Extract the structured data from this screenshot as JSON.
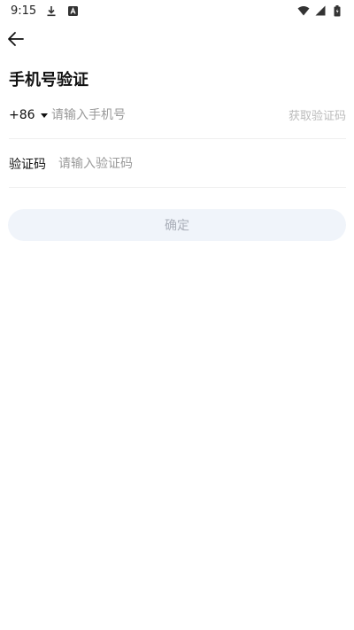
{
  "status_bar": {
    "time": "9:15",
    "left_icons": [
      "download-icon",
      "app-notification-icon"
    ],
    "right_icons": [
      "wifi-icon",
      "signal-icon",
      "battery-icon"
    ]
  },
  "header": {
    "back_icon": "arrow-left-icon"
  },
  "page": {
    "title": "手机号验证"
  },
  "phone_row": {
    "country_code": "+86",
    "phone_placeholder": "请输入手机号",
    "get_code_label": "获取验证码"
  },
  "code_row": {
    "label": "验证码",
    "code_placeholder": "请输入验证码"
  },
  "confirm_button": {
    "label": "确定"
  },
  "colors": {
    "button_bg": "#f0f4fa",
    "button_text": "#a9aeb8",
    "placeholder": "#9a9a9a",
    "get_code_disabled": "#bbbbbb"
  }
}
